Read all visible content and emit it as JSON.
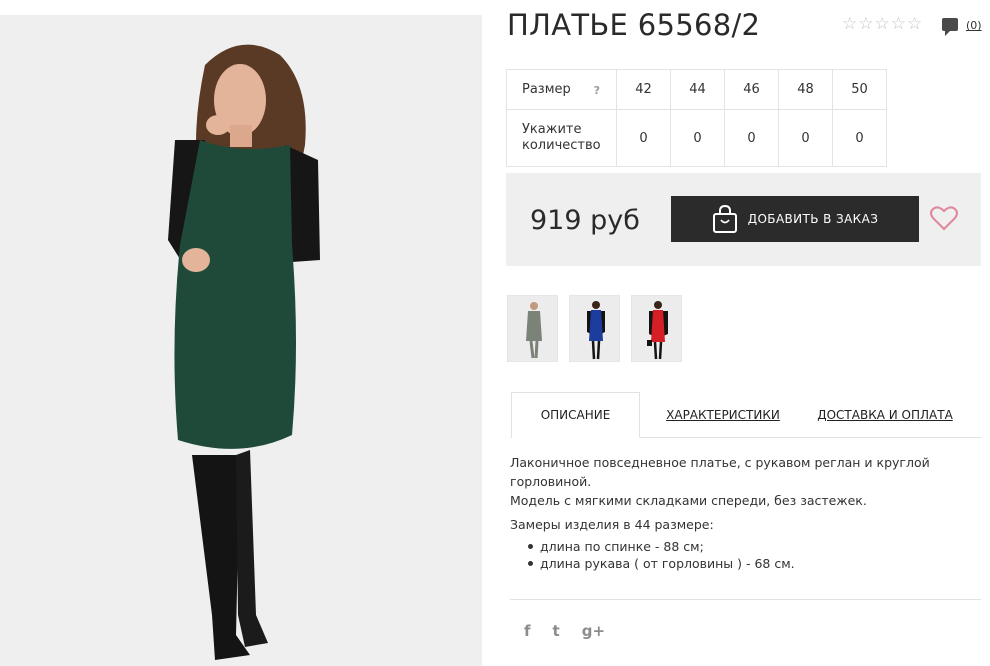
{
  "product": {
    "title": "ПЛАТЬЕ 65568/2",
    "rating_stars": 0,
    "rating_max": 5,
    "reviews_count": "(0)"
  },
  "size_table": {
    "size_label": "Размер",
    "help_mark": "?",
    "qty_label": "Укажите количество",
    "sizes": [
      "42",
      "44",
      "46",
      "48",
      "50"
    ],
    "quantities": [
      "0",
      "0",
      "0",
      "0",
      "0"
    ]
  },
  "purchase": {
    "price": "919 руб",
    "add_button_label": "ДОБАВИТЬ В ЗАКАЗ"
  },
  "thumbnails": [
    {
      "dress_color": "#7b8278",
      "sleeve_color": "#7b8278"
    },
    {
      "dress_color": "#1d3d9e",
      "sleeve_color": "#141414"
    },
    {
      "dress_color": "#d41f27",
      "sleeve_color": "#141414"
    }
  ],
  "tabs": [
    {
      "label": "ОПИСАНИЕ",
      "active": true
    },
    {
      "label": "ХАРАКТЕРИСТИКИ",
      "active": false
    },
    {
      "label": "ДОСТАВКА И ОПЛАТА",
      "active": false
    }
  ],
  "description": {
    "line1": "Лаконичное повседневное платье, с рукавом реглан и круглой горловиной.",
    "line2": "Модель с мягкими складками спереди, без застежек.",
    "measure_title": "Замеры изделия в 44 размере:",
    "measures": [
      "длина по спинке - 88 см;",
      "длина рукава ( от горловины ) - 68 см."
    ]
  },
  "social": [
    "f",
    "t",
    "g+"
  ],
  "colors": {
    "dress_main": "#1f4a3a",
    "button_bg": "#2b2b2b",
    "heart": "#e0869a",
    "price_box_bg": "#efefef"
  }
}
